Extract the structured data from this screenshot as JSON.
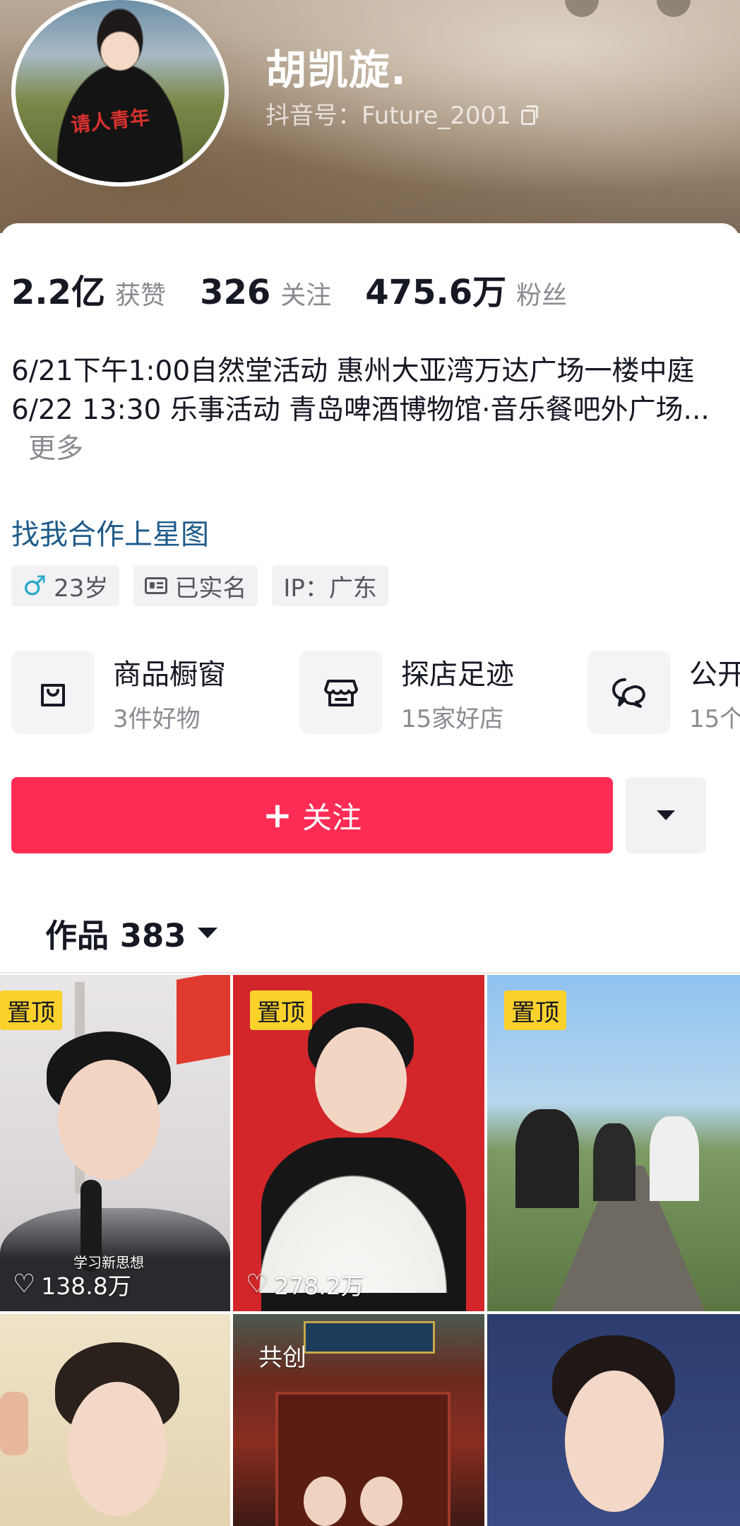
{
  "profile": {
    "name": "胡凯旋.",
    "douyin_id_label": "抖音号：",
    "douyin_id": "Future_2001",
    "avatar_print": "请人青年"
  },
  "stats": [
    {
      "value": "2.2亿",
      "label": "获赞"
    },
    {
      "value": "326",
      "label": "关注"
    },
    {
      "value": "475.6万",
      "label": "粉丝"
    }
  ],
  "bio": {
    "line1": "6/21下午1:00自然堂活动 惠州大亚湾万达广场一楼中庭",
    "line2": "6/22 13:30  乐事活动 青岛啤酒博物馆·音乐餐吧外广场...",
    "more": "更多"
  },
  "xingtu_link": "找我合作上星图",
  "tags": {
    "age": "23岁",
    "verified": "已实名",
    "ip": "IP：广东"
  },
  "features": [
    {
      "title": "商品橱窗",
      "sub": "3件好物",
      "icon": "shopping-bag-icon"
    },
    {
      "title": "探店足迹",
      "sub": "15家好店",
      "icon": "store-icon"
    },
    {
      "title": "公开",
      "sub": "15个",
      "icon": "chat-bubbles-icon"
    }
  ],
  "follow_button": "关注",
  "works_tab": {
    "label": "作品",
    "count": "383"
  },
  "videos": [
    {
      "badge": "置顶",
      "likes": "138.8万",
      "caption": "学习新思想"
    },
    {
      "badge": "置顶",
      "likes": "278.2万"
    },
    {
      "badge": "置顶"
    },
    {},
    {
      "tag": "共创"
    },
    {}
  ],
  "colors": {
    "accent": "#fe2c55",
    "pin_badge": "#fbd12c",
    "link": "#1f5b8a"
  }
}
